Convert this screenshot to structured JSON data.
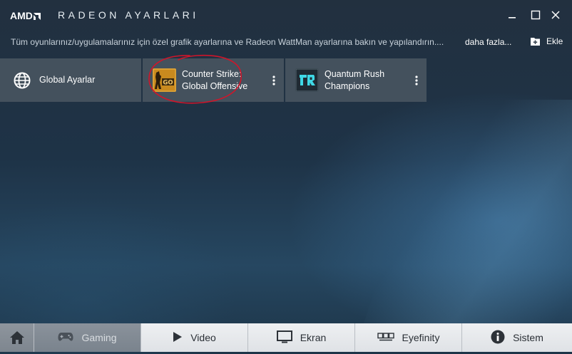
{
  "window": {
    "brand": "AMD",
    "title": "RADEON AYARLARI"
  },
  "header": {
    "description": "Tüm oyunlarınız/uygulamalarınız için özel grafik ayarlarına ve Radeon WattMan ayarlarına bakın ve yapılandırın....",
    "more_link": "daha fazla...",
    "add_label": "Ekle"
  },
  "tiles": [
    {
      "label": "Global Ayarlar",
      "icon": "globe-icon"
    },
    {
      "line1": "Counter Strike:",
      "line2": "Global Offensive",
      "icon": "csgo-icon"
    },
    {
      "line1": "Quantum Rush",
      "line2": "Champions",
      "icon": "quantum-rush-icon"
    }
  ],
  "nav": {
    "gaming": "Gaming",
    "video": "Video",
    "display": "Ekran",
    "eyefinity": "Eyefinity",
    "system": "Sistem",
    "active": "gaming"
  },
  "colors": {
    "annotation": "#d0152a",
    "tile_bg": "#485460",
    "nav_bg": "#e6e8eb"
  }
}
